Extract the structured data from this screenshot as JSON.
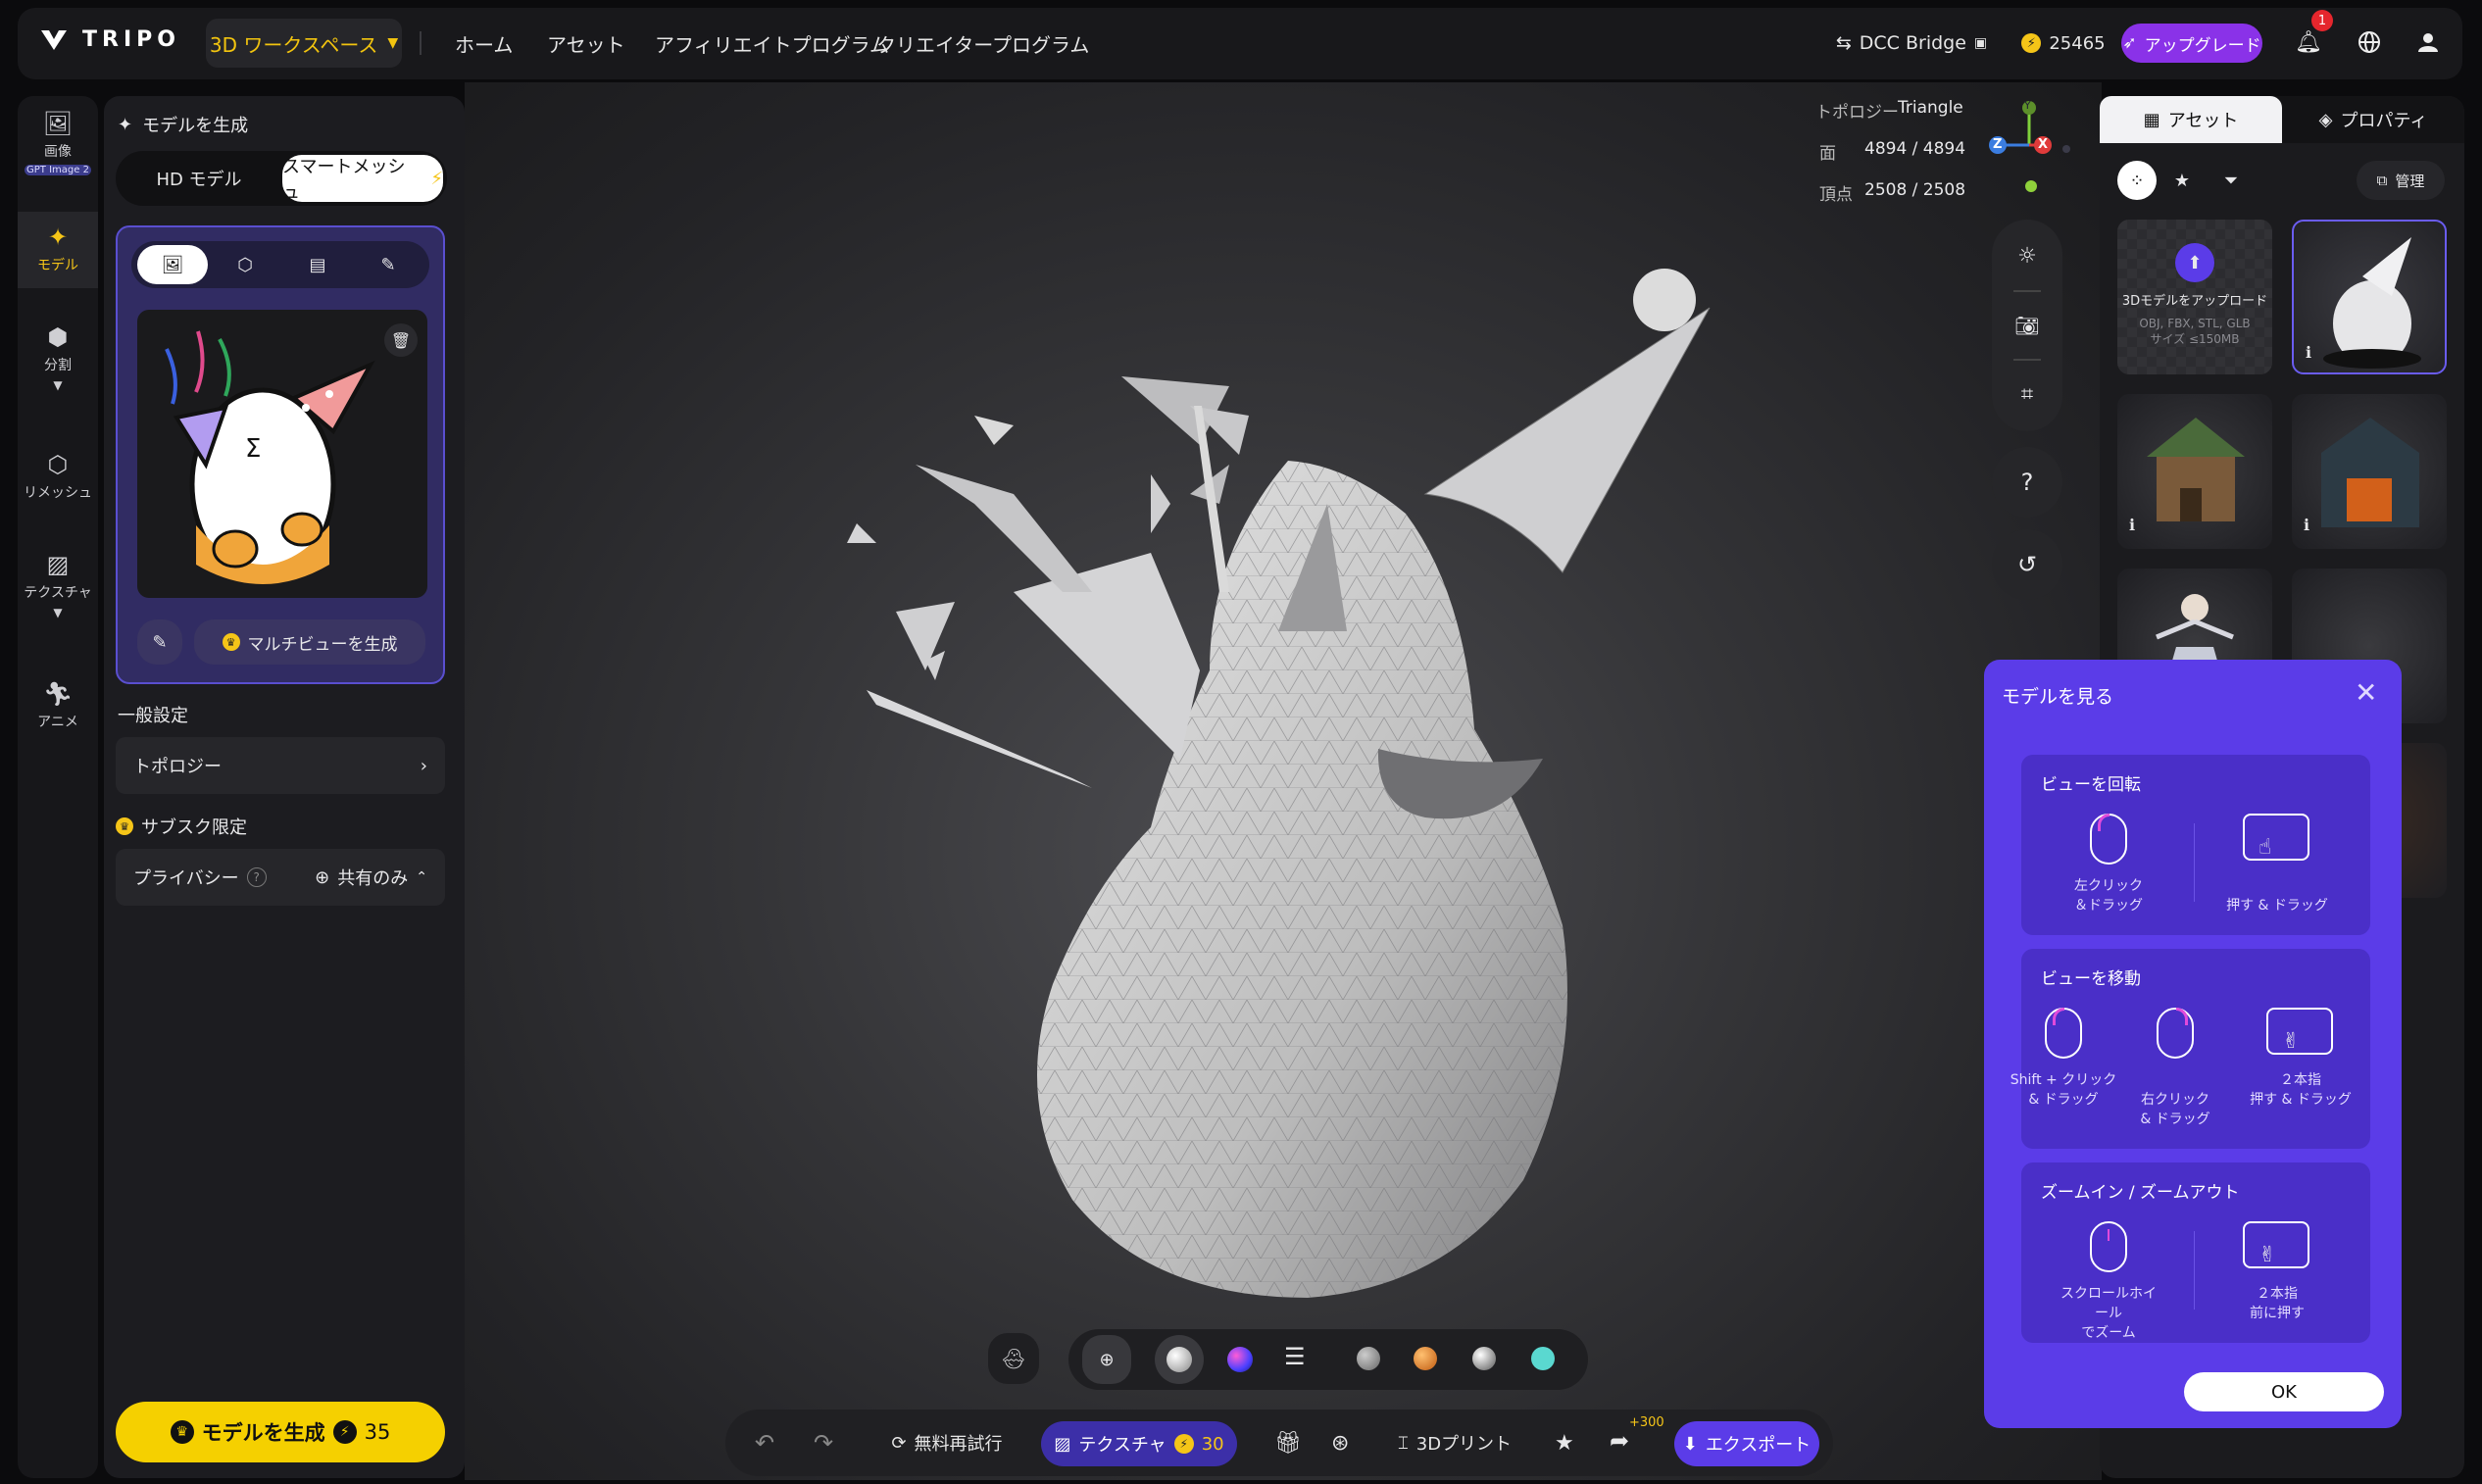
{
  "topbar": {
    "logo": "TRIPO",
    "workspace": "3D ワークスペース",
    "nav": [
      "ホーム",
      "アセット",
      "アフィリエイトプログラム",
      "クリエイタープログラム"
    ],
    "dcc": "DCC Bridge",
    "credits": "25465",
    "upgrade": "アップグレード",
    "notif_count": "1"
  },
  "rail": {
    "items": [
      {
        "label": "画像",
        "badge": "GPT Image 2"
      },
      {
        "label": "モデル"
      },
      {
        "label": "分割"
      },
      {
        "label": "リメッシュ"
      },
      {
        "label": "テクスチャ"
      },
      {
        "label": "アニメ"
      }
    ]
  },
  "panel": {
    "title": "モデルを生成",
    "tabs": [
      "HD モデル",
      "スマートメッシュ"
    ],
    "multiview": "マルチビューを生成",
    "general": "一般設定",
    "topology": "トポロジー",
    "sub_only": "サブスク限定",
    "privacy_label": "プライバシー",
    "privacy_value": "共有のみ",
    "generate": "モデルを生成",
    "generate_cost": "35"
  },
  "stats": {
    "topology_label": "トポロジー",
    "topology_value": "Triangle",
    "faces_label": "面",
    "faces_value": "4894 / 4894",
    "verts_label": "頂点",
    "verts_value": "2508 / 2508"
  },
  "gizmo": {
    "y": "Y",
    "z": "Z",
    "x": "X"
  },
  "right": {
    "tabs": [
      "アセット",
      "プロパティ"
    ],
    "manage": "管理",
    "upload_title": "3Dモデルをアップロード",
    "upload_formats": "OBJ, FBX, STL, GLB",
    "upload_size": "サイズ ≤150MB"
  },
  "dialog": {
    "title": "モデルを見る",
    "sections": [
      {
        "title": "ビューを回転",
        "items": [
          "左クリック\n＆ドラッグ",
          "押す & ドラッグ"
        ]
      },
      {
        "title": "ビューを移動",
        "items": [
          "Shift + クリック\n& ドラッグ",
          "右クリック\n& ドラッグ",
          "２本指\n押す & ドラッグ"
        ]
      },
      {
        "title": "ズームイン / ズームアウト",
        "items": [
          "スクロールホイール\nでズーム",
          "２本指\n前に押す"
        ]
      }
    ],
    "ok": "OK"
  },
  "bottombar": {
    "retry": "無料再試行",
    "texture": "テクスチャ",
    "texture_cost": "30",
    "print": "3Dプリント",
    "share_bonus": "+300",
    "export": "エクスポート"
  },
  "colors": {
    "accent": "#5b3ce8",
    "yellow": "#f5c518",
    "purple": "#7b4dff"
  }
}
